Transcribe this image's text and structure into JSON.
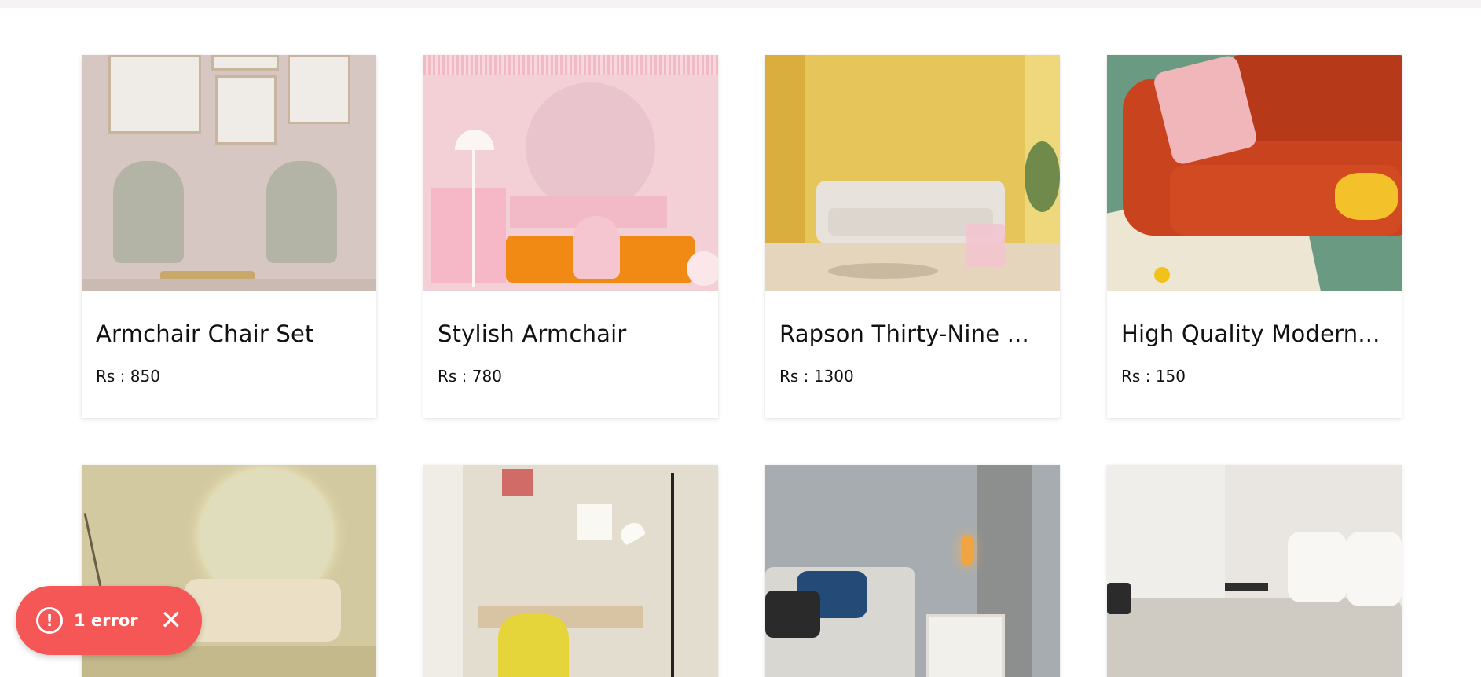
{
  "products": [
    {
      "title": "Armchair Chair Set",
      "price": "Rs : 850"
    },
    {
      "title": "Stylish Armchair",
      "price": "Rs : 780"
    },
    {
      "title": "Rapson Thirty-Nine ...",
      "price": "Rs : 1300"
    },
    {
      "title": "High Quality Modern...",
      "price": "Rs : 150"
    }
  ],
  "toast": {
    "icon": "!",
    "text": "1 error",
    "close": "✕"
  },
  "colors": {
    "toast_bg": "#f55757",
    "accent_orange": "#c9431f"
  }
}
